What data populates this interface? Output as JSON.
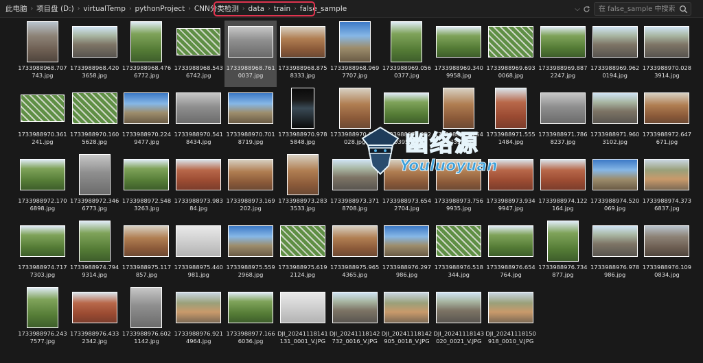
{
  "breadcrumb": [
    "此电脑",
    "项目盘 (D:)",
    "virtualTemp",
    "pythonProject",
    "CNN分类检测",
    "data",
    "train",
    "false_sample"
  ],
  "search": {
    "placeholder": "在 false_sample 中搜索"
  },
  "watermark": {
    "text": "幽络源",
    "sub": "Youluoyuan"
  },
  "selected_index": 4,
  "files": [
    {
      "name": "1733988968.707743.jpg",
      "thumb": "t-rock",
      "shape": "portrait"
    },
    {
      "name": "1733988968.4203658.jpg",
      "thumb": "t-road",
      "shape": "land"
    },
    {
      "name": "1733988968.4766772.jpg",
      "thumb": "t-green",
      "shape": "portrait"
    },
    {
      "name": "1733988968.5436742.jpg",
      "thumb": "t-grid",
      "shape": "wide"
    },
    {
      "name": "1733988968.7610037.jpg",
      "thumb": "t-grey",
      "shape": "land"
    },
    {
      "name": "1733988968.8758333.jpg",
      "thumb": "t-brown",
      "shape": "land"
    },
    {
      "name": "1733988968.9697707.jpg",
      "thumb": "t-sky",
      "shape": "portrait"
    },
    {
      "name": "1733988969.0560377.jpg",
      "thumb": "t-green",
      "shape": "portrait"
    },
    {
      "name": "1733988969.3409958.jpg",
      "thumb": "t-green",
      "shape": "land"
    },
    {
      "name": "1733988969.6930068.jpg",
      "thumb": "t-grid",
      "shape": "land"
    },
    {
      "name": "1733988969.8872247.jpg",
      "thumb": "t-green",
      "shape": "land"
    },
    {
      "name": "1733988969.9620194.jpg",
      "thumb": "t-road",
      "shape": "land"
    },
    {
      "name": "1733988970.0283914.jpg",
      "thumb": "t-road",
      "shape": "land"
    },
    {
      "name": "1733988970.361241.jpg",
      "thumb": "t-grid",
      "shape": "wide"
    },
    {
      "name": "1733988970.1605628.jpg",
      "thumb": "t-grid",
      "shape": "land"
    },
    {
      "name": "1733988970.2249477.jpg",
      "thumb": "t-sky",
      "shape": "land"
    },
    {
      "name": "1733988970.5418434.jpg",
      "thumb": "t-grey",
      "shape": "land"
    },
    {
      "name": "1733988970.7018719.jpg",
      "thumb": "t-sky",
      "shape": "land"
    },
    {
      "name": "1733988970.9785848.jpg",
      "thumb": "t-dark",
      "shape": "tall"
    },
    {
      "name": "1733988970.972028.jpg",
      "thumb": "t-brown",
      "shape": "portrait"
    },
    {
      "name": "1733988971.0520395.jpg",
      "thumb": "t-green",
      "shape": "land"
    },
    {
      "name": "1733988971.2547739.jpg",
      "thumb": "t-brown",
      "shape": "portrait"
    },
    {
      "name": "1733988971.5551484.jpg",
      "thumb": "t-red",
      "shape": "portrait"
    },
    {
      "name": "1733988971.7868237.jpg",
      "thumb": "t-grey",
      "shape": "land"
    },
    {
      "name": "1733988971.9603102.jpg",
      "thumb": "t-road",
      "shape": "land"
    },
    {
      "name": "1733988972.647671.jpg",
      "thumb": "t-brown",
      "shape": "land"
    },
    {
      "name": "1733988972.1706898.jpg",
      "thumb": "t-green",
      "shape": "land"
    },
    {
      "name": "1733988972.3466773.jpg",
      "thumb": "t-grey",
      "shape": "portrait"
    },
    {
      "name": "1733988972.5483263.jpg",
      "thumb": "t-green",
      "shape": "land"
    },
    {
      "name": "1733988973.98384.jpg",
      "thumb": "t-red",
      "shape": "land"
    },
    {
      "name": "1733988973.169202.jpg",
      "thumb": "t-brown",
      "shape": "land"
    },
    {
      "name": "1733988973.2833533.jpg",
      "thumb": "t-brown",
      "shape": "portrait"
    },
    {
      "name": "1733988973.3718708.jpg",
      "thumb": "t-road",
      "shape": "land"
    },
    {
      "name": "1733988973.6542704.jpg",
      "thumb": "t-brown",
      "shape": "land"
    },
    {
      "name": "1733988973.7569935.jpg",
      "thumb": "t-brown",
      "shape": "land"
    },
    {
      "name": "1733988973.9349947.jpg",
      "thumb": "t-red",
      "shape": "land"
    },
    {
      "name": "1733988974.122164.jpg",
      "thumb": "t-red",
      "shape": "land"
    },
    {
      "name": "1733988974.520069.jpg",
      "thumb": "t-sky",
      "shape": "land"
    },
    {
      "name": "1733988974.3736837.jpg",
      "thumb": "t-mixed",
      "shape": "land"
    },
    {
      "name": "1733988974.7177303.jpg",
      "thumb": "t-green",
      "shape": "land"
    },
    {
      "name": "1733988974.7949314.jpg",
      "thumb": "t-green",
      "shape": "portrait"
    },
    {
      "name": "1733988975.117857.jpg",
      "thumb": "t-brown",
      "shape": "land"
    },
    {
      "name": "1733988975.440981.jpg",
      "thumb": "t-white",
      "shape": "land"
    },
    {
      "name": "1733988975.5592968.jpg",
      "thumb": "t-sky",
      "shape": "land"
    },
    {
      "name": "1733988975.6192124.jpg",
      "thumb": "t-grid",
      "shape": "land"
    },
    {
      "name": "1733988975.9654365.jpg",
      "thumb": "t-brown",
      "shape": "land"
    },
    {
      "name": "1733988976.297986.jpg",
      "thumb": "t-sky",
      "shape": "land"
    },
    {
      "name": "1733988976.518344.jpg",
      "thumb": "t-grid",
      "shape": "land"
    },
    {
      "name": "1733988976.654764.jpg",
      "thumb": "t-green",
      "shape": "land"
    },
    {
      "name": "1733988976.734877.jpg",
      "thumb": "t-green",
      "shape": "portrait"
    },
    {
      "name": "1733988976.978986.jpg",
      "thumb": "t-road",
      "shape": "land"
    },
    {
      "name": "1733988976.1090834.jpg",
      "thumb": "t-rock",
      "shape": "land"
    },
    {
      "name": "1733988976.2437577.jpg",
      "thumb": "t-green",
      "shape": "portrait"
    },
    {
      "name": "1733988976.4332342.jpg",
      "thumb": "t-red",
      "shape": "land"
    },
    {
      "name": "1733988976.6021142.jpg",
      "thumb": "t-grey",
      "shape": "portrait"
    },
    {
      "name": "1733988976.9214964.jpg",
      "thumb": "t-mixed",
      "shape": "land"
    },
    {
      "name": "1733988977.1666036.jpg",
      "thumb": "t-green",
      "shape": "land"
    },
    {
      "name": "DJI_20241118141131_0001_V.JPG",
      "thumb": "t-white",
      "shape": "land"
    },
    {
      "name": "DJI_20241118142732_0016_V.JPG",
      "thumb": "t-road",
      "shape": "land"
    },
    {
      "name": "DJI_20241118142905_0018_V.JPG",
      "thumb": "t-mixed",
      "shape": "land"
    },
    {
      "name": "DJI_20241118143020_0021_V.JPG",
      "thumb": "t-road",
      "shape": "land"
    },
    {
      "name": "DJI_20241118150918_0010_V.JPG",
      "thumb": "t-mixed",
      "shape": "land"
    }
  ]
}
